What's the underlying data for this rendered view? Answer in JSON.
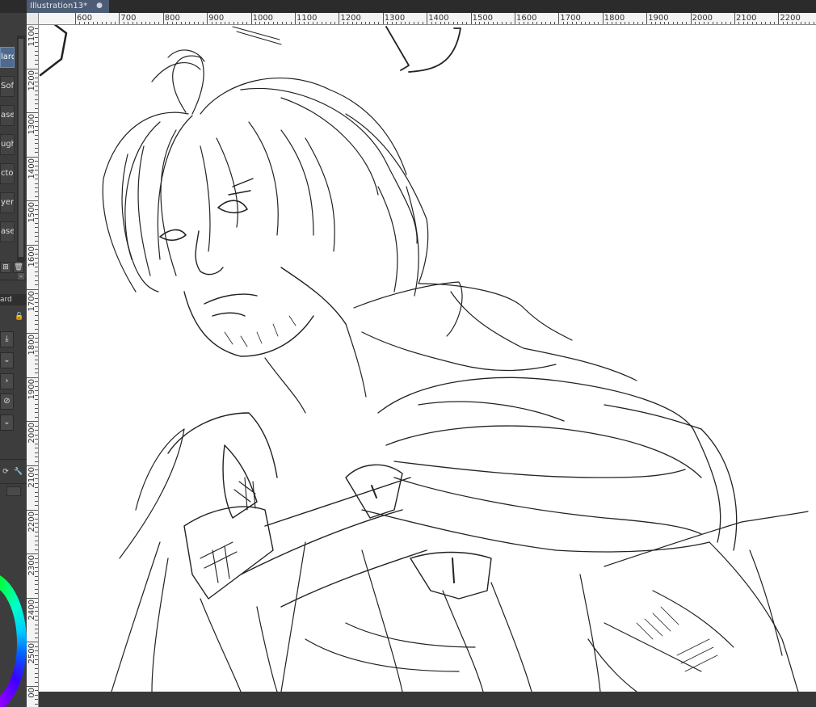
{
  "document": {
    "tab_title": "Illustration13*",
    "close_glyph": "●"
  },
  "brush_panel": {
    "items": [
      {
        "label": "lard",
        "active": true
      },
      {
        "label": "Soft",
        "active": false
      },
      {
        "label": "aser",
        "active": false
      },
      {
        "label": "ugh",
        "active": false
      },
      {
        "label": "ctor",
        "active": false
      },
      {
        "label": "yers",
        "active": false
      },
      {
        "label": "aser",
        "active": false
      }
    ],
    "scroll_arrow": "⌄",
    "new_icon": "⊞",
    "delete_icon": "🗑"
  },
  "layer_panel": {
    "header": "ard",
    "lock_icon": "🔓",
    "download_icon": "⤓",
    "dropdown_icon": "⌄",
    "arrow_icon": "›",
    "clear_icon": "⊘",
    "dropdown2_icon": "⌄"
  },
  "tool_icons": {
    "refresh": "⟳",
    "wrench": "🔧"
  },
  "rulers": {
    "horizontal": [
      "600",
      "700",
      "800",
      "900",
      "1000",
      "1100",
      "1200",
      "1300",
      "1400",
      "1500",
      "1600",
      "1700",
      "1800",
      "1900",
      "2000",
      "2100",
      "2200"
    ],
    "vertical": [
      "1100",
      "1200",
      "1300",
      "1400",
      "1500",
      "1600",
      "1700",
      "1800",
      "1900",
      "2000",
      "2100",
      "2200",
      "2300",
      "2400",
      "2500",
      "00"
    ]
  },
  "colors": {
    "accent": "#4f6a8c",
    "tab": "#4b5c74",
    "panel": "#3d3d3d",
    "canvas": "#ffffff"
  }
}
